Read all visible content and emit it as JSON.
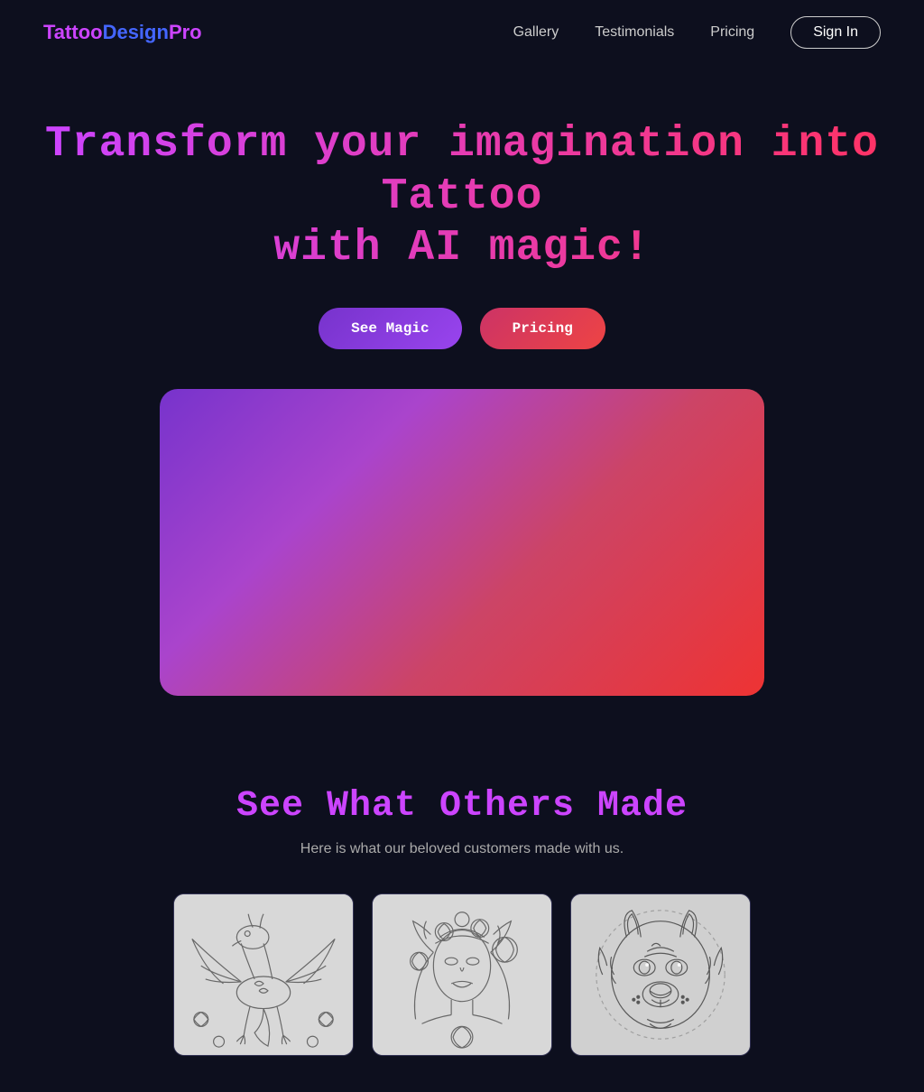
{
  "nav": {
    "logo": "TattooDesignPro",
    "logo_part1": "Tattoo",
    "logo_part2": "Design",
    "logo_part3": "Pro",
    "links": [
      {
        "label": "Gallery",
        "href": "#gallery"
      },
      {
        "label": "Testimonials",
        "href": "#testimonials"
      },
      {
        "label": "Pricing",
        "href": "#pricing"
      }
    ],
    "signin_label": "Sign In"
  },
  "hero": {
    "title": "Transform your imagination into Tattoo\nwith AI magic!",
    "button_magic": "See Magic",
    "button_pricing": "Pricing"
  },
  "gallery": {
    "title": "See What Others Made",
    "subtitle": "Here is what our beloved customers made with us.",
    "items": [
      {
        "alt": "Dragon tattoo sketch"
      },
      {
        "alt": "Woman with flowers tattoo sketch"
      },
      {
        "alt": "Wolf tattoo sketch"
      }
    ]
  }
}
